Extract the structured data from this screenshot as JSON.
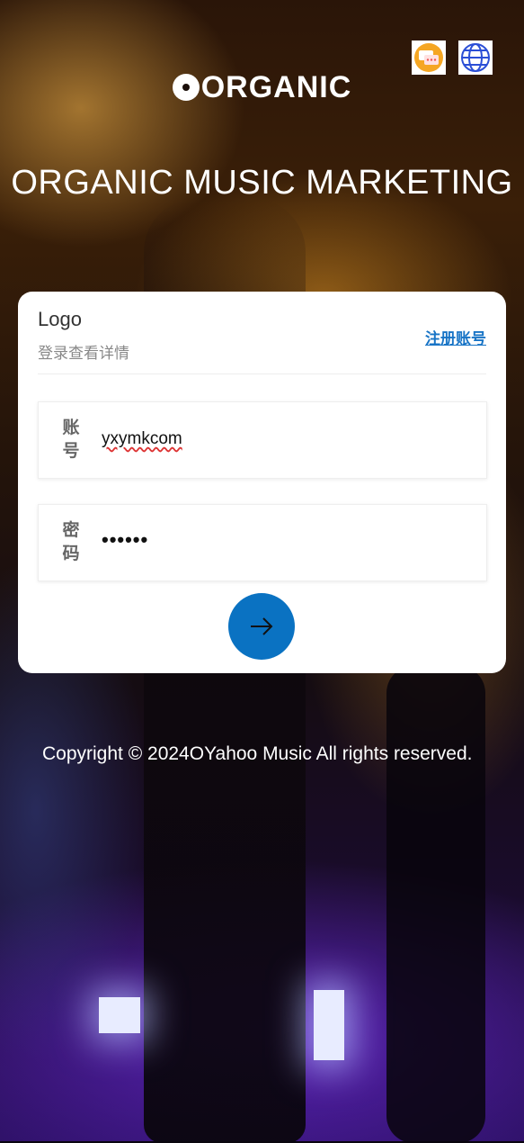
{
  "header": {
    "brand_name": "ORGANIC",
    "headline": "ORGANIC MUSIC MARKETING",
    "icons": [
      "chat-icon",
      "globe-icon"
    ]
  },
  "login_card": {
    "title": "Logo",
    "subtitle": "登录查看详情",
    "register_link": "注册账号",
    "username_label": "账号",
    "username_value": "yxymkcom",
    "password_label": "密码",
    "password_value": "••••••",
    "submit_icon": "arrow-right-icon"
  },
  "footer": {
    "copyright": "Copyright © 2024OYahoo Music All rights reserved."
  },
  "colors": {
    "accent": "#0a72c2",
    "link": "#1874c6"
  }
}
